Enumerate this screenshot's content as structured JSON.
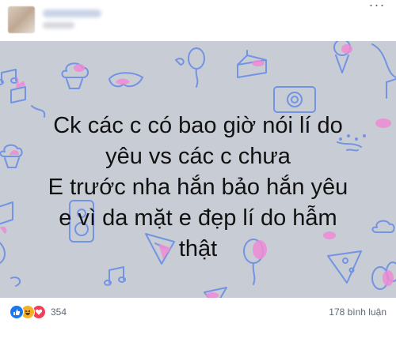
{
  "post": {
    "author": "",
    "lines": [
      "Ck các c có bao giờ nói lí do",
      "yêu vs các c chưa",
      "E trước nha hắn bảo hắn yêu",
      "e vì da mặt e đẹp lí do hẫm",
      "thật"
    ]
  },
  "reactions": {
    "types": [
      "like-icon",
      "haha-icon",
      "love-icon"
    ],
    "count": "354"
  },
  "comments": {
    "label": "178 bình luận"
  },
  "colors": {
    "background": "#c8ccd4",
    "doodle_blue": "#6f8fe0",
    "doodle_pink": "#ef8bd4",
    "like": "#1877f2",
    "haha": "#f7b125",
    "love": "#f33e58"
  }
}
